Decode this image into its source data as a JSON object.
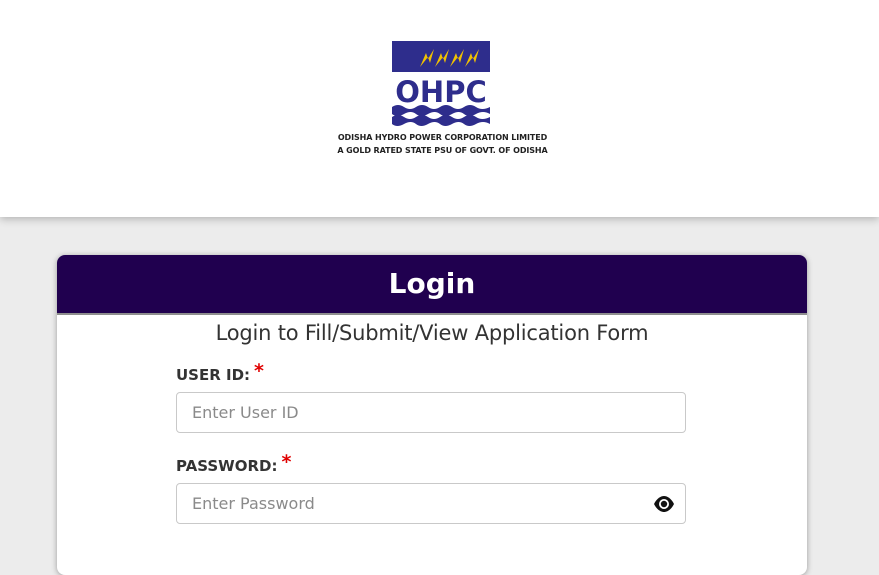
{
  "header": {
    "logo": {
      "text": "OHPC",
      "line1": "ODISHA HYDRO POWER CORPORATION LIMITED",
      "line2": "A GOLD RATED STATE PSU OF GOVT. OF ODISHA",
      "colors": {
        "emblem": "#2e2d8c",
        "bolt": "#f2c200"
      }
    }
  },
  "login": {
    "title": "Login",
    "subtitle": "Login to Fill/Submit/View Application Form",
    "header_color": "#20004f",
    "user_id": {
      "label": "USER ID:",
      "required_mark": "*",
      "placeholder": "Enter User ID",
      "value": ""
    },
    "password": {
      "label": "PASSWORD:",
      "required_mark": "*",
      "placeholder": "Enter Password",
      "value": "",
      "toggle_icon": "eye-icon"
    }
  }
}
